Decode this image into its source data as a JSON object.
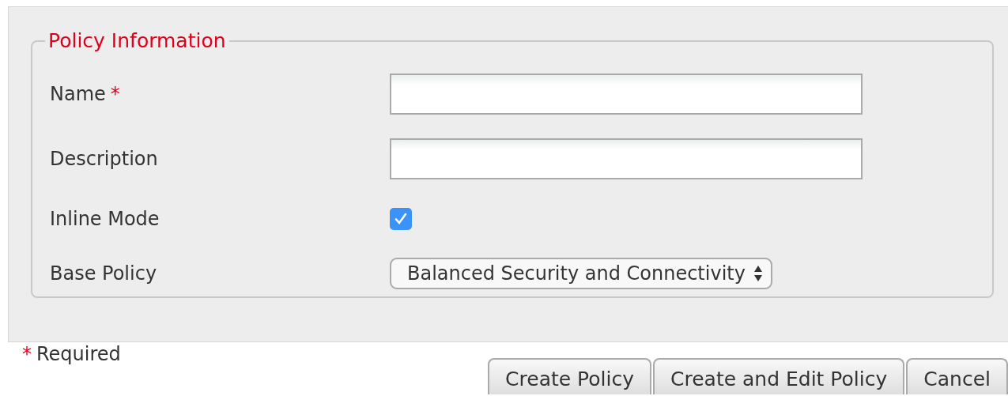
{
  "fieldset": {
    "legend": "Policy Information",
    "fields": [
      {
        "kind": "text",
        "label": "Name",
        "required_mark": "*"
      },
      {
        "kind": "text",
        "label": "Description"
      },
      {
        "kind": "checkbox",
        "label": "Inline Mode",
        "checked": true
      },
      {
        "kind": "select",
        "label": "Base Policy",
        "value": "Balanced Security and Connectivity"
      }
    ]
  },
  "required_note": {
    "mark": "*",
    "text": "Required"
  },
  "buttons": [
    "Create Policy",
    "Create and Edit Policy",
    "Cancel"
  ]
}
